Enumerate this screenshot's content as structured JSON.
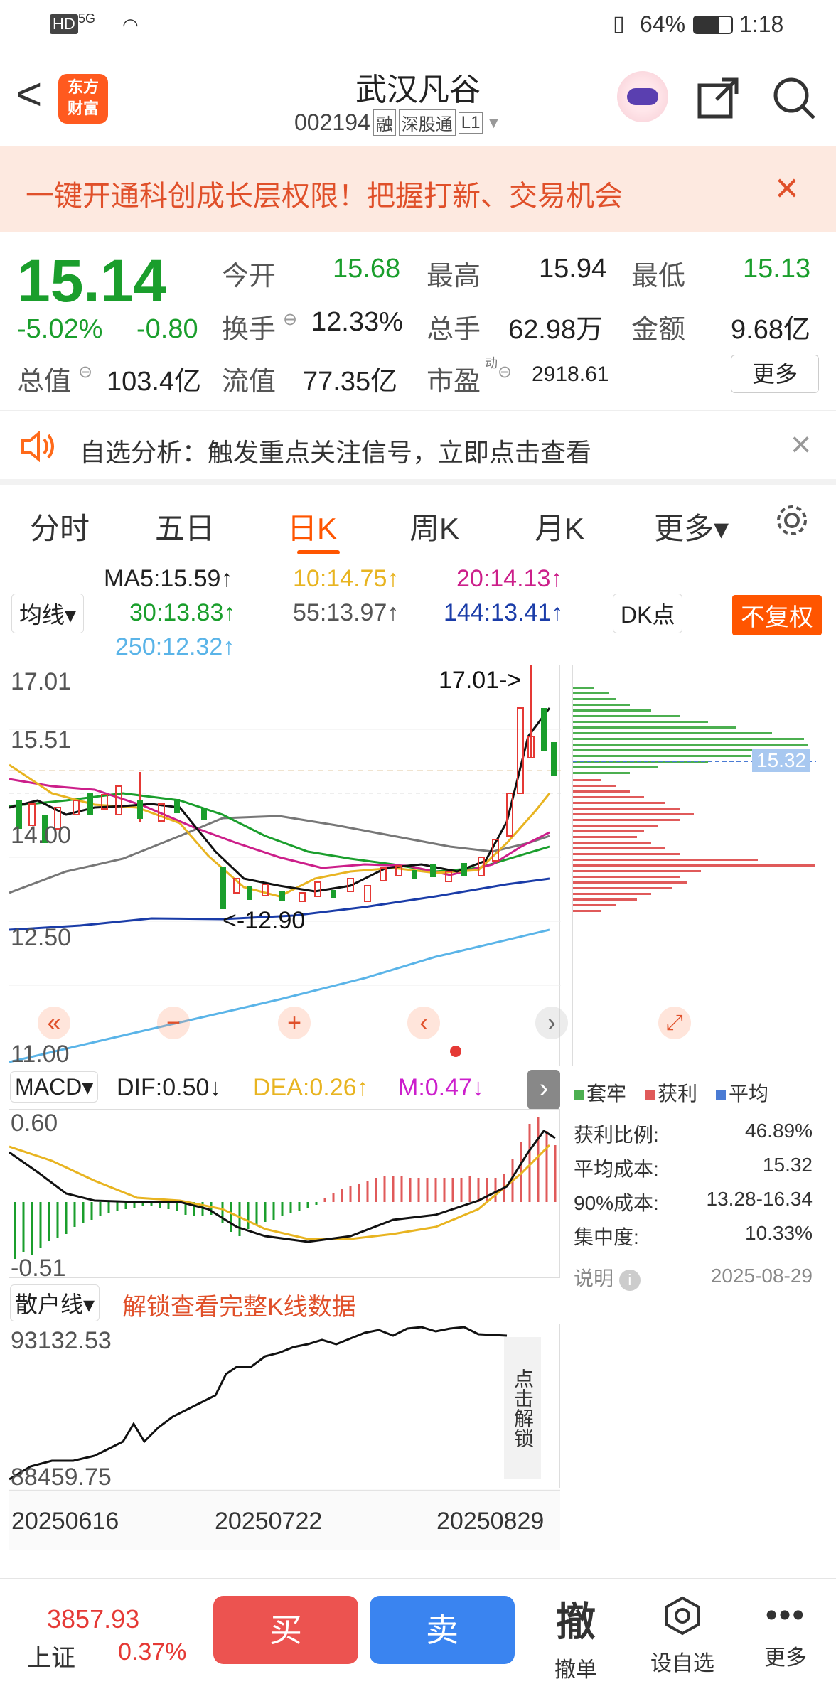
{
  "status": {
    "net": "HD",
    "signal": "5G",
    "battery": "64%",
    "time": "1:18"
  },
  "header": {
    "back": "<",
    "brand": "东方\n财富",
    "title": "武汉凡谷",
    "code": "002194",
    "tags": [
      "融",
      "深股通",
      "L1"
    ]
  },
  "banner": {
    "text": "一键开通科创成长层权限！把握打新、交易机会",
    "close": "×"
  },
  "quote": {
    "price": "15.14",
    "pct": "-5.02%",
    "chg": "-0.80",
    "open_l": "今开",
    "open": "15.68",
    "high_l": "最高",
    "high": "15.94",
    "low_l": "最低",
    "low": "15.13",
    "turn_l": "换手",
    "turn": "12.33%",
    "vol_l": "总手",
    "vol": "62.98万",
    "amt_l": "金额",
    "amt": "9.68亿",
    "cap_l": "总值",
    "cap": "103.4亿",
    "flt_l": "流值",
    "flt": "77.35亿",
    "pe_l": "市盈",
    "pe_sup": "动",
    "pe": "2918.61",
    "more": "更多"
  },
  "notice": {
    "text": "自选分析：触发重点关注信号，立即点击查看",
    "close": "×"
  },
  "tabs": [
    "分时",
    "五日",
    "日K",
    "周K",
    "月K",
    "更多▾"
  ],
  "ma": {
    "select": "均线▾",
    "ma5": "MA5:15.59↑",
    "ma10": "10:14.75↑",
    "ma20": "20:14.13↑",
    "ma30": "30:13.83↑",
    "ma55": "55:13.97↑",
    "ma144": "144:13.41↑",
    "ma250": "250:12.32↑",
    "dk": "DK点",
    "fq": "不复权"
  },
  "mainchart": {
    "y_labels": [
      "17.01",
      "15.51",
      "14.00",
      "12.50",
      "11.00"
    ],
    "max_lbl": "17.01->",
    "min_lbl": "<-12.90",
    "profile_price": "15.32"
  },
  "macd": {
    "select": "MACD▾",
    "dif": "DIF:0.50↓",
    "dea": "DEA:0.26↑",
    "m": "M:0.47↓",
    "top": "0.60",
    "bottom": "-0.51"
  },
  "side": {
    "legend": [
      "套牢",
      "获利",
      "平均"
    ],
    "rows": [
      [
        "获利比例:",
        "46.89%"
      ],
      [
        "平均成本:",
        "15.32"
      ],
      [
        "90%成本:",
        "13.28-16.34"
      ],
      [
        "集中度:",
        "10.33%"
      ]
    ],
    "note": "说明",
    "date": "2025-08-29"
  },
  "san": {
    "select": "散户线▾",
    "unlock": "解锁查看完整K线数据",
    "top": "93132.53",
    "bottom": "88459.75",
    "side": "点击解锁"
  },
  "dates": [
    "20250616",
    "20250722",
    "20250829"
  ],
  "bottom": {
    "index": "3857.93",
    "index_name": "上证",
    "index_pct": "0.37%",
    "buy": "买",
    "sell": "卖",
    "cancel_icon": "撤",
    "cancel": "撤单",
    "fav": "设自选",
    "more": "更多"
  },
  "colors": {
    "up": "#e53935",
    "down": "#1a9e2c",
    "accent": "#ff5500"
  }
}
